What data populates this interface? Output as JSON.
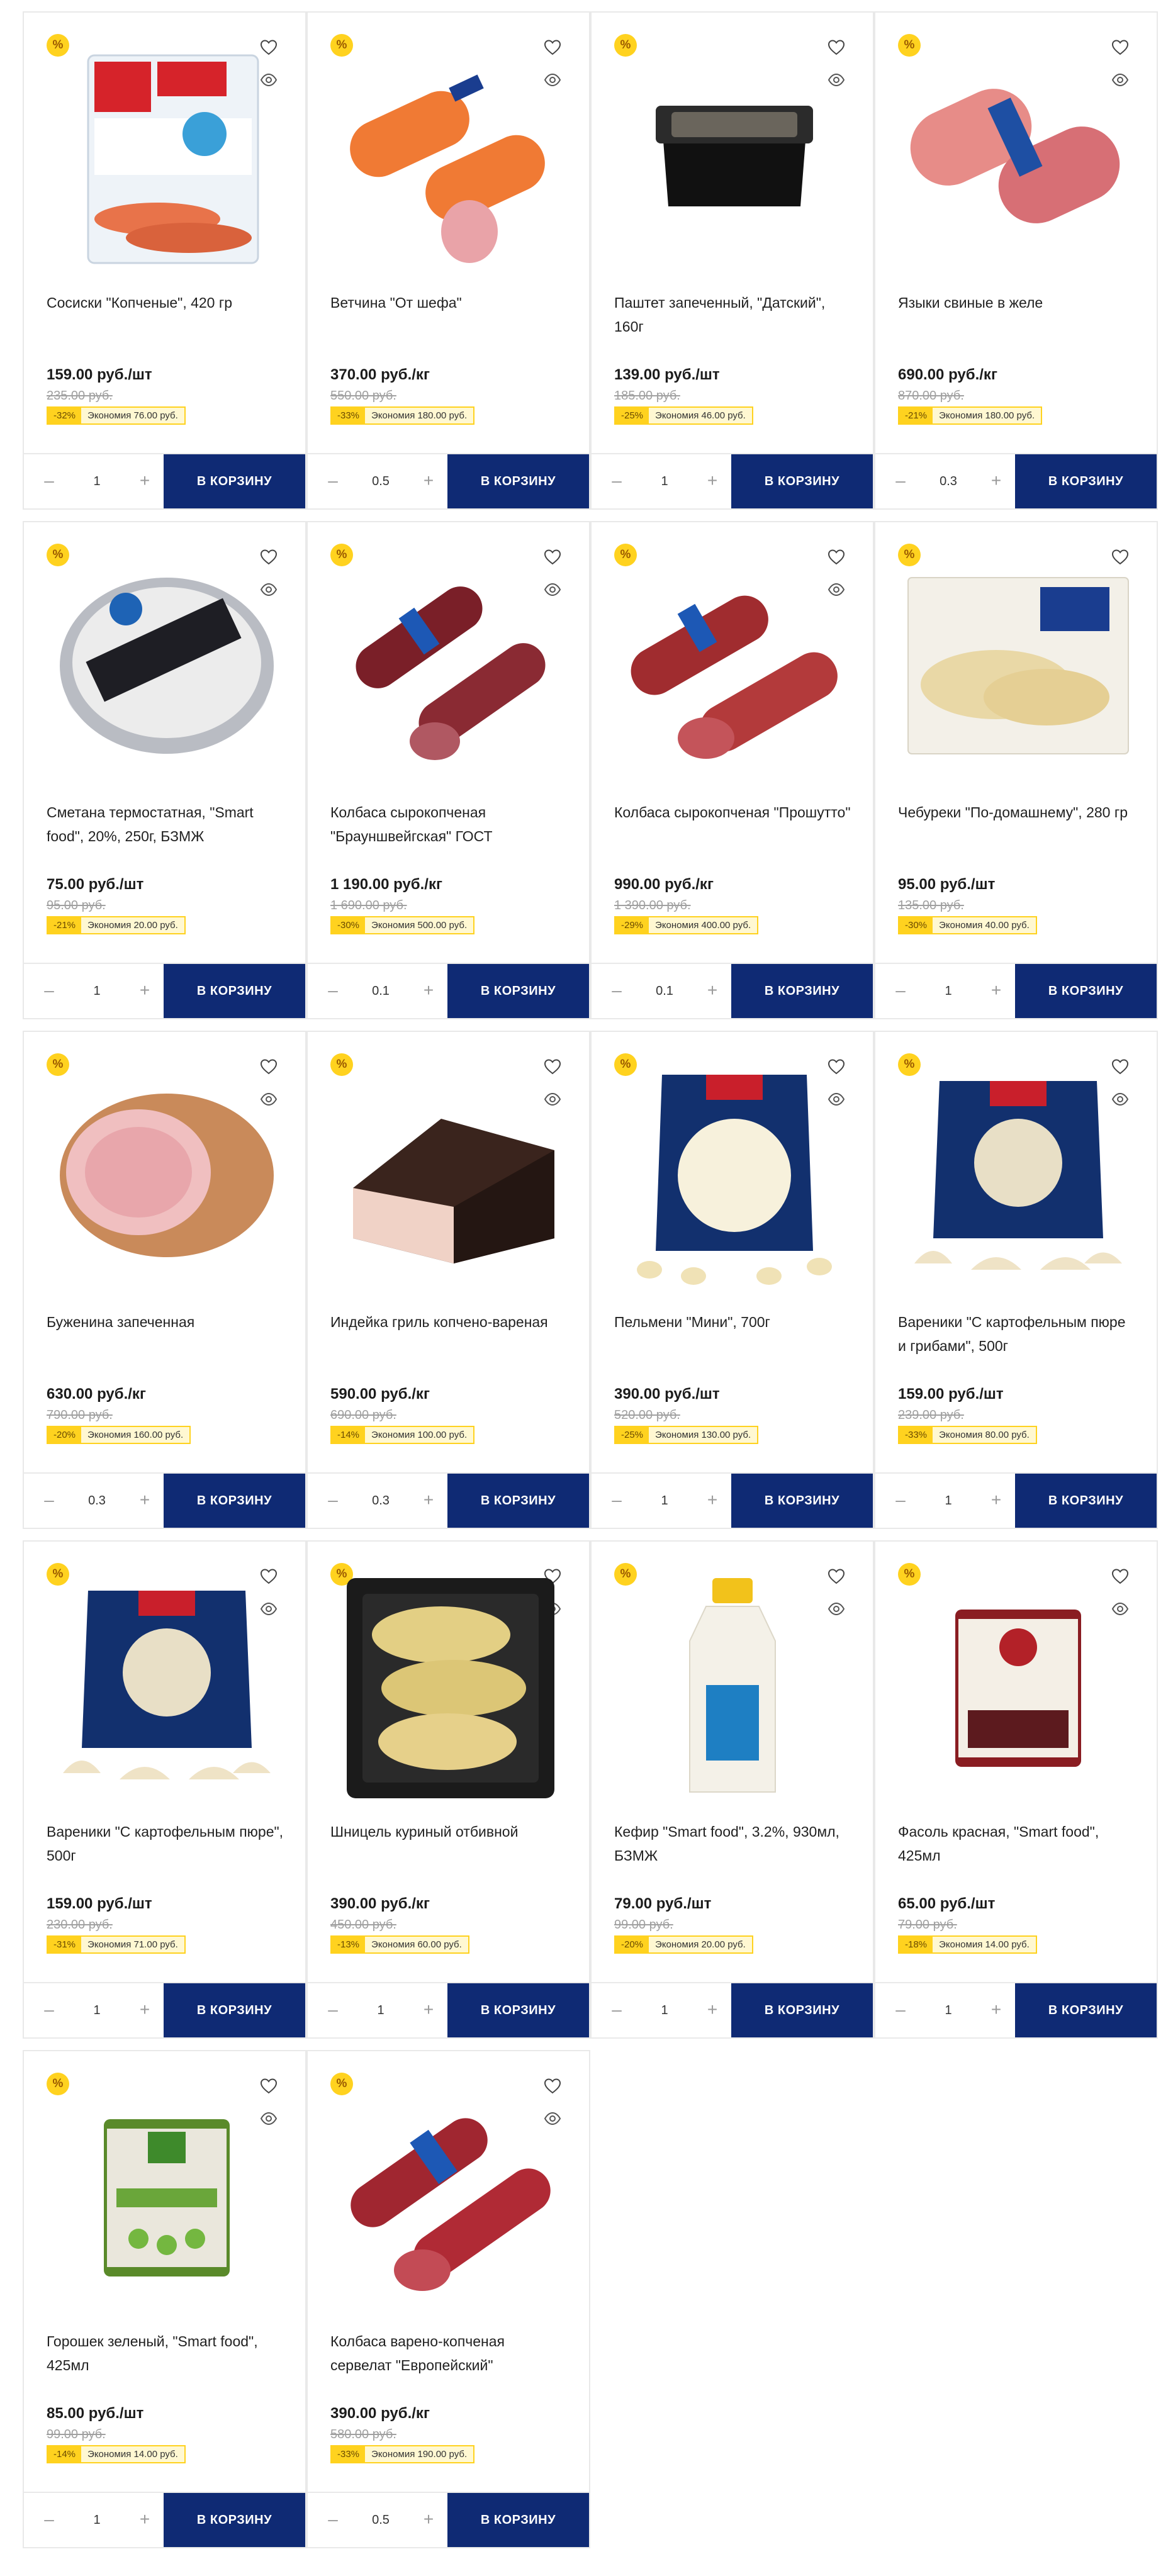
{
  "labels": {
    "discount_badge": "%",
    "cart_button": "В КОРЗИНУ",
    "minus": "–",
    "plus": "+"
  },
  "colors": {
    "badge": "#ffd21f",
    "cart_button": "#0f2a74",
    "promo_bg": "#fff8d2"
  },
  "products": [
    {
      "name": "Сосиски \"Копченые\", 420 гр",
      "price": "159.00 руб./шт",
      "old_price": "235.00 руб.",
      "discount": "-32%",
      "savings": "Экономия 76.00 руб.",
      "qty": "1",
      "image": "sausages-pack",
      "wishlist_icon": "heart-icon",
      "quick_view_icon": "eye-icon"
    },
    {
      "name": "Ветчина \"От шефа\"",
      "price": "370.00 руб./кг",
      "old_price": "550.00 руб.",
      "discount": "-33%",
      "savings": "Экономия 180.00 руб.",
      "qty": "0.5",
      "image": "ham-logs",
      "wishlist_icon": "heart-icon",
      "quick_view_icon": "eye-icon"
    },
    {
      "name": "Паштет запеченный, \"Датский\", 160г",
      "price": "139.00 руб./шт",
      "old_price": "185.00 руб.",
      "discount": "-25%",
      "savings": "Экономия 46.00 руб.",
      "qty": "1",
      "image": "pate-tray",
      "wishlist_icon": "heart-icon",
      "quick_view_icon": "eye-icon"
    },
    {
      "name": "Языки свиные в желе",
      "price": "690.00 руб./кг",
      "old_price": "870.00 руб.",
      "discount": "-21%",
      "savings": "Экономия 180.00 руб.",
      "qty": "0.3",
      "image": "tongue-rolls",
      "wishlist_icon": "heart-icon",
      "quick_view_icon": "eye-icon"
    },
    {
      "name": "Сметана термостатная, \"Smart food\", 20%, 250г, БЗМЖ",
      "price": "75.00 руб./шт",
      "old_price": "95.00 руб.",
      "discount": "-21%",
      "savings": "Экономия 20.00 руб.",
      "qty": "1",
      "image": "sour-cream-cup",
      "wishlist_icon": "heart-icon",
      "quick_view_icon": "eye-icon"
    },
    {
      "name": "Колбаса сырокопченая \"Брауншвейгская\" ГОСТ",
      "price": "1 190.00 руб./кг",
      "old_price": "1 690.00 руб.",
      "discount": "-30%",
      "savings": "Экономия 500.00 руб.",
      "qty": "0.1",
      "image": "salami-dark",
      "wishlist_icon": "heart-icon",
      "quick_view_icon": "eye-icon"
    },
    {
      "name": "Колбаса сырокопченая \"Прошутто\"",
      "price": "990.00 руб./кг",
      "old_price": "1 390.00 руб.",
      "discount": "-29%",
      "savings": "Экономия 400.00 руб.",
      "qty": "0.1",
      "image": "salami-red",
      "wishlist_icon": "heart-icon",
      "quick_view_icon": "eye-icon"
    },
    {
      "name": "Чебуреки \"По-домашнему\", 280 гр",
      "price": "95.00 руб./шт",
      "old_price": "135.00 руб.",
      "discount": "-30%",
      "savings": "Экономия 40.00 руб.",
      "qty": "1",
      "image": "cheburek-pack",
      "wishlist_icon": "heart-icon",
      "quick_view_icon": "eye-icon"
    },
    {
      "name": "Буженина запеченная",
      "price": "630.00 руб./кг",
      "old_price": "790.00 руб.",
      "discount": "-20%",
      "savings": "Экономия 160.00 руб.",
      "qty": "0.3",
      "image": "baked-pork",
      "wishlist_icon": "heart-icon",
      "quick_view_icon": "eye-icon"
    },
    {
      "name": "Индейка гриль копчено-вареная",
      "price": "590.00 руб./кг",
      "old_price": "690.00 руб.",
      "discount": "-14%",
      "savings": "Экономия 100.00 руб.",
      "qty": "0.3",
      "image": "smoked-turkey",
      "wishlist_icon": "heart-icon",
      "quick_view_icon": "eye-icon"
    },
    {
      "name": "Пельмени \"Мини\", 700г",
      "price": "390.00 руб./шт",
      "old_price": "520.00 руб.",
      "discount": "-25%",
      "savings": "Экономия 130.00 руб.",
      "qty": "1",
      "image": "pelmeni-bag",
      "wishlist_icon": "heart-icon",
      "quick_view_icon": "eye-icon"
    },
    {
      "name": "Вареники \"С картофельным пюре и грибами\", 500г",
      "price": "159.00 руб./шт",
      "old_price": "239.00 руб.",
      "discount": "-33%",
      "savings": "Экономия 80.00 руб.",
      "qty": "1",
      "image": "vareniki-bag",
      "wishlist_icon": "heart-icon",
      "quick_view_icon": "eye-icon"
    },
    {
      "name": "Вареники \"С картофельным пюре\", 500г",
      "price": "159.00 руб./шт",
      "old_price": "230.00 руб.",
      "discount": "-31%",
      "savings": "Экономия 71.00 руб.",
      "qty": "1",
      "image": "vareniki-bag",
      "wishlist_icon": "heart-icon",
      "quick_view_icon": "eye-icon"
    },
    {
      "name": "Шницель куриный отбивной",
      "price": "390.00 руб./кг",
      "old_price": "450.00 руб.",
      "discount": "-13%",
      "savings": "Экономия 60.00 руб.",
      "qty": "1",
      "image": "schnitzel-tray",
      "wishlist_icon": "heart-icon",
      "quick_view_icon": "eye-icon"
    },
    {
      "name": "Кефир \"Smart food\", 3.2%, 930мл, БЗМЖ",
      "price": "79.00 руб./шт",
      "old_price": "99.00 руб.",
      "discount": "-20%",
      "savings": "Экономия 20.00 руб.",
      "qty": "1",
      "image": "kefir-bottle",
      "wishlist_icon": "heart-icon",
      "quick_view_icon": "eye-icon"
    },
    {
      "name": "Фасоль красная, \"Smart food\", 425мл",
      "price": "65.00 руб./шт",
      "old_price": "79.00 руб.",
      "discount": "-18%",
      "savings": "Экономия 14.00 руб.",
      "qty": "1",
      "image": "beans-can",
      "wishlist_icon": "heart-icon",
      "quick_view_icon": "eye-icon"
    },
    {
      "name": "Горошек зеленый, \"Smart food\", 425мл",
      "price": "85.00 руб./шт",
      "old_price": "99.00 руб.",
      "discount": "-14%",
      "savings": "Экономия 14.00 руб.",
      "qty": "1",
      "image": "peas-can",
      "wishlist_icon": "heart-icon",
      "quick_view_icon": "eye-icon"
    },
    {
      "name": "Колбаса варено-копченая сервелат \"Европейский\"",
      "price": "390.00 руб./кг",
      "old_price": "580.00 руб.",
      "discount": "-33%",
      "savings": "Экономия 190.00 руб.",
      "qty": "0.5",
      "image": "servelat",
      "wishlist_icon": "heart-icon",
      "quick_view_icon": "eye-icon"
    }
  ]
}
